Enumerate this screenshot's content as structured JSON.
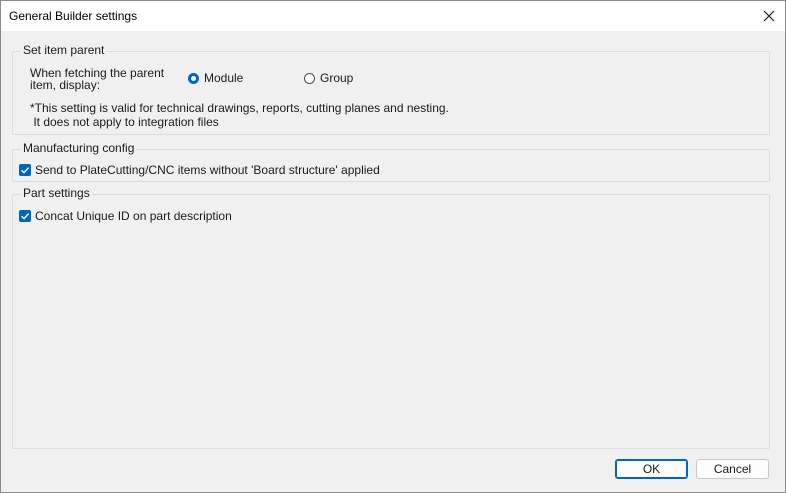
{
  "window": {
    "title": "General Builder settings"
  },
  "groups": {
    "parent": {
      "legend": "Set item parent",
      "fetch_label": "When fetching the parent\nitem, display:",
      "options": [
        {
          "label": "Module",
          "selected": true
        },
        {
          "label": "Group",
          "selected": false
        }
      ],
      "note": "*This setting is valid for technical drawings, reports, cutting planes and nesting.\n It does not apply to integration files"
    },
    "manufacturing": {
      "legend": "Manufacturing config",
      "checkbox_label": "Send to PlateCutting/CNC items without 'Board structure' applied",
      "checked": true
    },
    "part": {
      "legend": "Part settings",
      "checkbox_label": "Concat Unique ID on part description",
      "checked": true
    }
  },
  "buttons": {
    "ok": "OK",
    "cancel": "Cancel"
  },
  "colors": {
    "accent": "#0067c0",
    "background": "#f0f0f0",
    "titlebar": "#ffffff"
  },
  "icons": {
    "close": "close-icon",
    "check": "check-icon"
  }
}
